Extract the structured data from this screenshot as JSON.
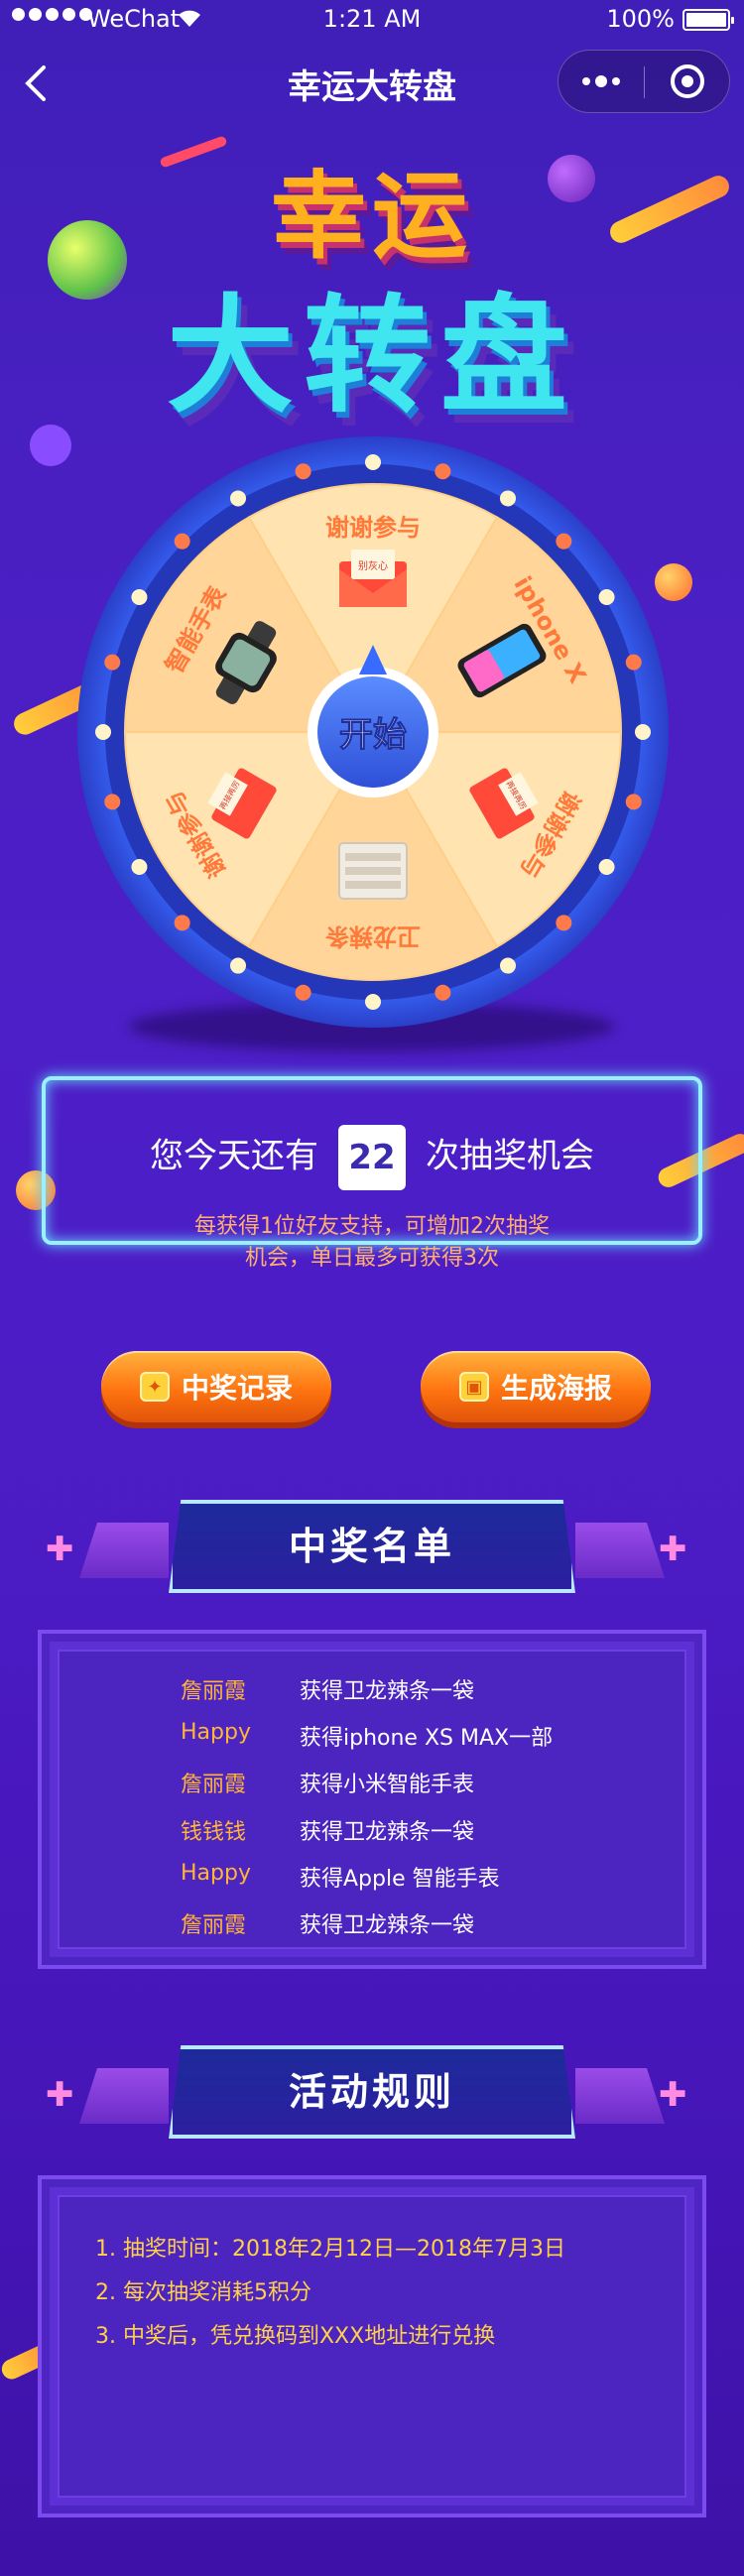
{
  "status_bar": {
    "carrier": "WeChat",
    "time": "1:21 AM",
    "battery": "100%"
  },
  "nav": {
    "title": "幸运大转盘"
  },
  "hero": {
    "line1": "幸运",
    "line2": "大转盘"
  },
  "wheel": {
    "center_label": "开始",
    "segments": [
      {
        "label": "谢谢参与",
        "prize_tag": "别灰心"
      },
      {
        "label": "iphone X",
        "prize_tag": ""
      },
      {
        "label": "谢谢参与",
        "prize_tag": "再接再厉"
      },
      {
        "label": "卫龙辣条",
        "prize_tag": ""
      },
      {
        "label": "谢谢参与",
        "prize_tag": "再接再厉"
      },
      {
        "label": "智能手表",
        "prize_tag": ""
      }
    ]
  },
  "chance": {
    "prefix": "您今天还有",
    "count": "22",
    "suffix": "次抽奖机会",
    "note_line1": "每获得1位好友支持，可增加2次抽奖",
    "note_line2": "机会，单日最多可获得3次"
  },
  "buttons": {
    "records": "中奖记录",
    "poster": "生成海报"
  },
  "winners": {
    "title": "中奖名单",
    "rows": [
      {
        "name": "詹丽霞",
        "prize": "获得卫龙辣条一袋"
      },
      {
        "name": "Happy",
        "prize": "获得iphone XS MAX一部"
      },
      {
        "name": "詹丽霞",
        "prize": "获得小米智能手表"
      },
      {
        "name": "钱钱钱",
        "prize": "获得卫龙辣条一袋"
      },
      {
        "name": "Happy",
        "prize": "获得Apple 智能手表"
      },
      {
        "name": "詹丽霞",
        "prize": "获得卫龙辣条一袋"
      }
    ]
  },
  "rules": {
    "title": "活动规则",
    "items": [
      "1. 抽奖时间：2018年2月12日—2018年7月3日",
      "2. 每次抽奖消耗5积分",
      "3. 中奖后，凭兑换码到XXX地址进行兑换"
    ]
  },
  "colors": {
    "accent_orange": "#ff7a14",
    "name_gold": "#ffb43a",
    "rule_yellow": "#ffd14a",
    "note_orange": "#ffb070",
    "neon": "#9af0ff"
  }
}
